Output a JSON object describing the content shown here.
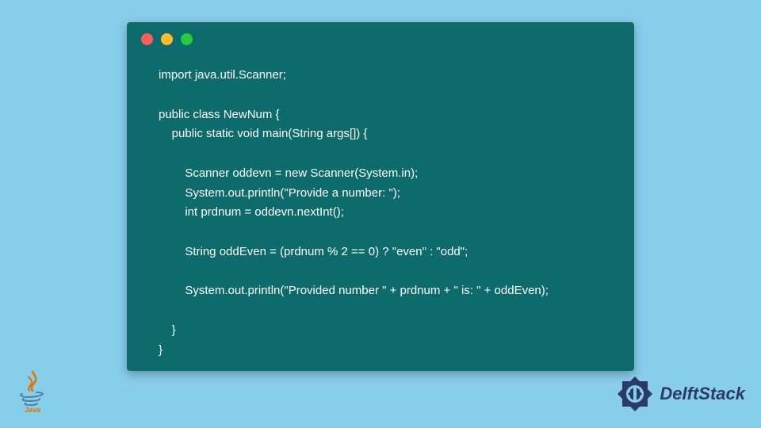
{
  "code": {
    "lines": [
      "import java.util.Scanner;",
      "",
      "public class NewNum {",
      "    public static void main(String args[]) {",
      "",
      "        Scanner oddevn = new Scanner(System.in);",
      "        System.out.println(\"Provide a number: \");",
      "        int prdnum = oddevn.nextInt();",
      "",
      "        String oddEven = (prdnum % 2 == 0) ? \"even\" : \"odd\";",
      "",
      "        System.out.println(\"Provided number \" + prdnum + \" is: \" + oddEven);",
      "",
      "    }",
      "}"
    ]
  },
  "logos": {
    "java_label": "Java",
    "delft_label": "DelftStack"
  },
  "colors": {
    "background": "#87ceeb",
    "code_bg": "#0d6b6b",
    "code_text": "#ffffff",
    "delft_blue": "#2b3a6b",
    "java_red": "#e76f00",
    "java_blue": "#5382a1"
  }
}
